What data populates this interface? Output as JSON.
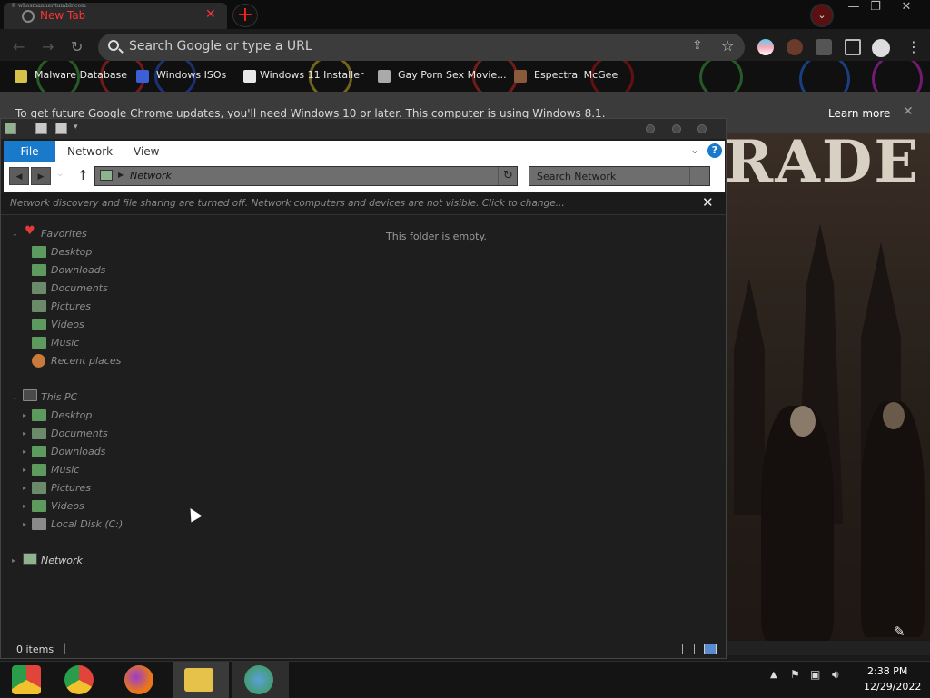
{
  "browser": {
    "tab_title": "New Tab",
    "tab_caption": "© whosmanner.tumblr.com",
    "tab_close": "✕",
    "new_tab_symbol": "+",
    "omnibox_placeholder": "Search Google or type a URL",
    "bookmarks": [
      {
        "label": "Malware Database",
        "icon_color": "#d6c14a"
      },
      {
        "label": "Windows ISOs",
        "icon_color": "#3a5fd6"
      },
      {
        "label": "Windows 11 Installer",
        "icon_color": "#e8e8e8"
      },
      {
        "label": "Gay Porn Sex Movie...",
        "icon_color": "#aaaaaa"
      },
      {
        "label": "Espectral McGee",
        "icon_color": "#8a5a3a"
      }
    ],
    "infobar_message": "To get future Google Chrome updates, you'll need Windows 10 or later. This computer is using Windows 8.1.",
    "infobar_link": "Learn more",
    "background_word": "RADE"
  },
  "explorer": {
    "ribbon_tabs": [
      "File",
      "Network",
      "View"
    ],
    "address_location": "Network",
    "search_placeholder": "Search Network",
    "network_notice": "Network discovery and file sharing are turned off. Network computers and devices are not visible. Click to change...",
    "empty_message": "This folder is empty.",
    "favorites_label": "Favorites",
    "favorites": [
      {
        "label": "Desktop",
        "color": "#5d9a5d"
      },
      {
        "label": "Downloads",
        "color": "#5d9a5d"
      },
      {
        "label": "Documents",
        "color": "#6a8a6a"
      },
      {
        "label": "Pictures",
        "color": "#6a8a6a"
      },
      {
        "label": "Videos",
        "color": "#5d9a5d"
      },
      {
        "label": "Music",
        "color": "#5d9a5d"
      },
      {
        "label": "Recent places",
        "color": "#c87a3a"
      }
    ],
    "thispc_label": "This PC",
    "thispc": [
      {
        "label": "Desktop",
        "color": "#5d9a5d"
      },
      {
        "label": "Documents",
        "color": "#6a8a6a"
      },
      {
        "label": "Downloads",
        "color": "#5d9a5d"
      },
      {
        "label": "Music",
        "color": "#5d9a5d"
      },
      {
        "label": "Pictures",
        "color": "#6a8a6a"
      },
      {
        "label": "Videos",
        "color": "#5d9a5d"
      },
      {
        "label": "Local Disk (C:)",
        "color": "#8a8a8a"
      }
    ],
    "network_label": "Network",
    "status_count": "0 items"
  },
  "taskbar": {
    "apps": [
      {
        "name": "chrome-canary",
        "color": "#2b6fd0"
      },
      {
        "name": "chrome",
        "color": "#e0443a"
      },
      {
        "name": "firefox",
        "color": "#e8771a"
      },
      {
        "name": "file-explorer",
        "color": "#e6c24a"
      },
      {
        "name": "people-app",
        "color": "#5aa0d8"
      }
    ],
    "time": "2:38 PM",
    "date": "12/29/2022"
  }
}
